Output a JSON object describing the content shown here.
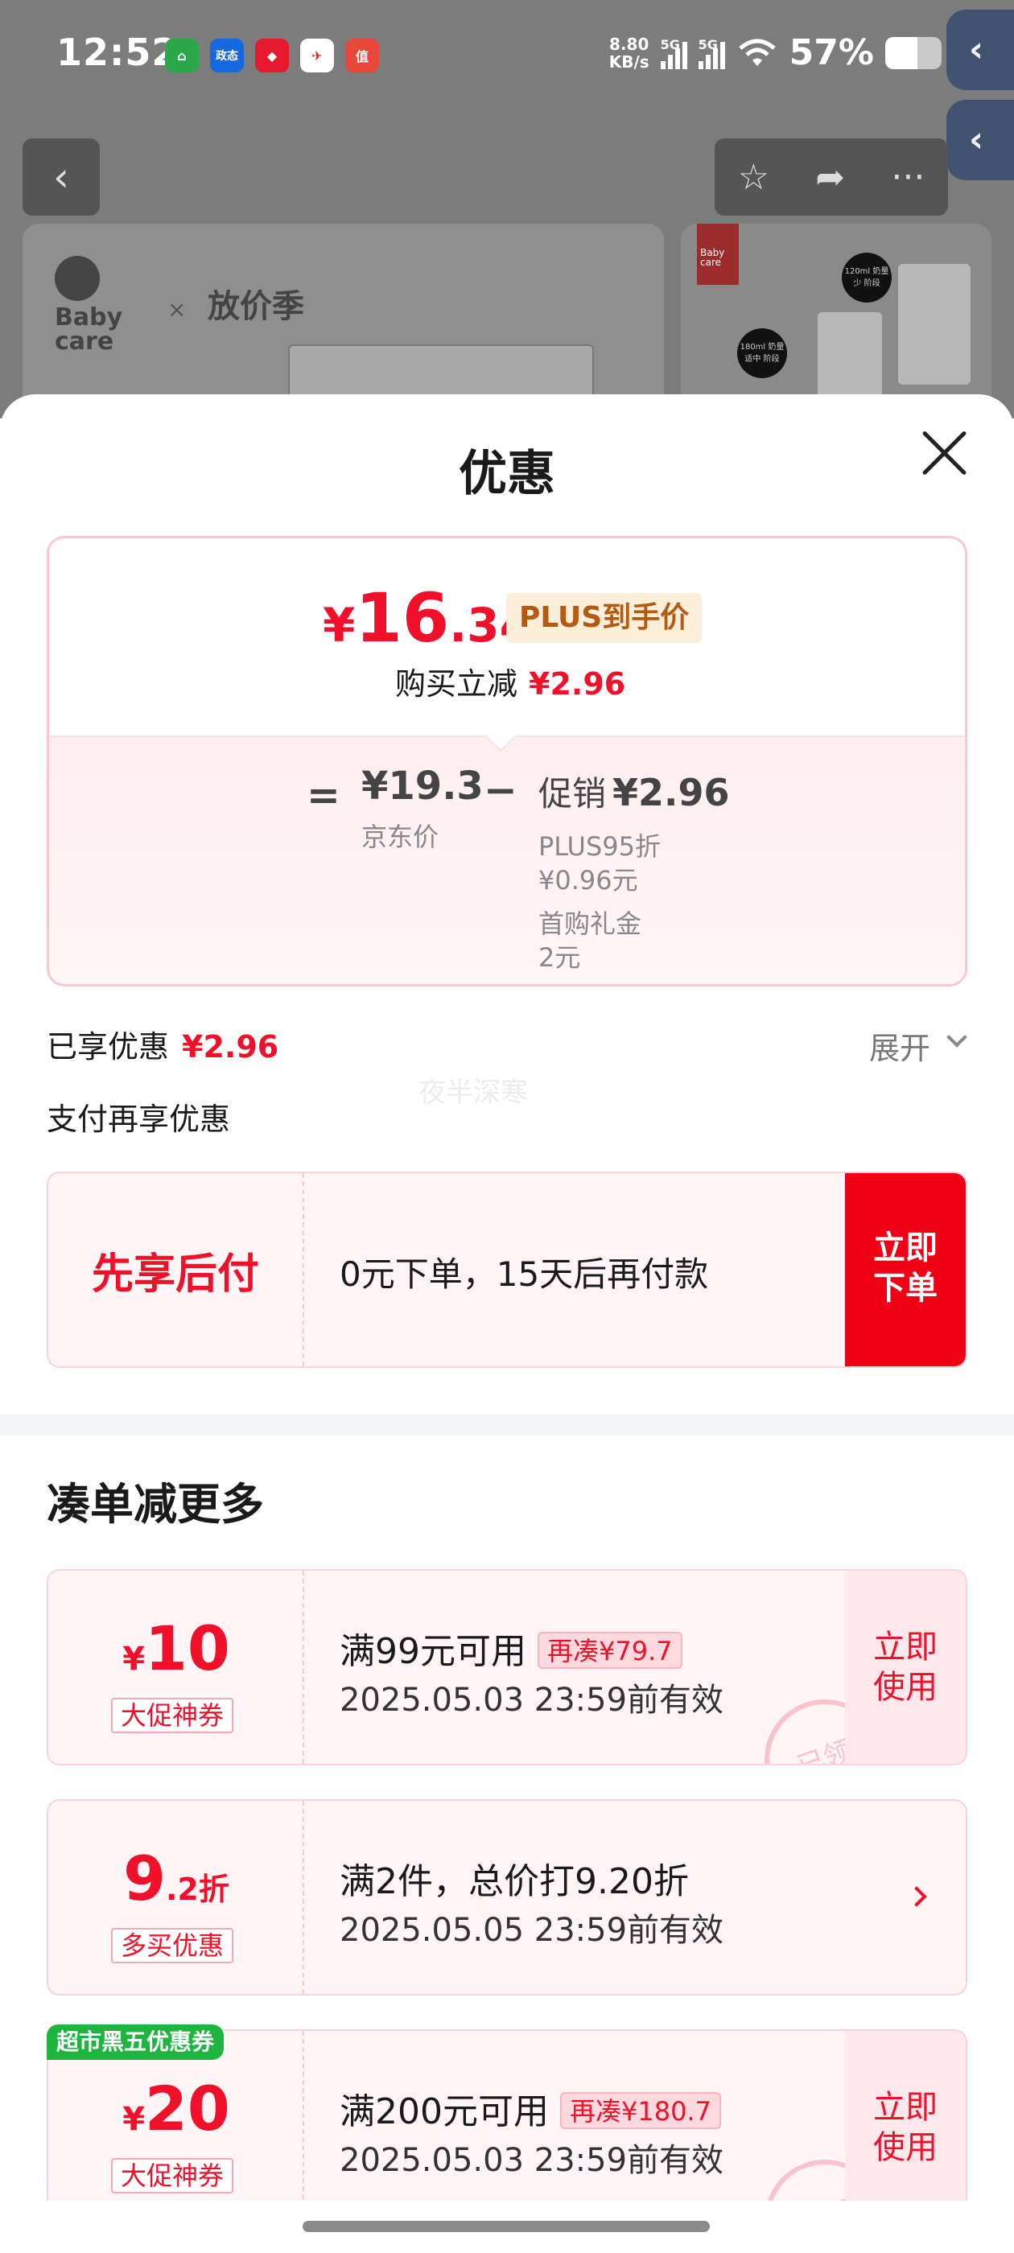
{
  "status_bar": {
    "time": "12:52",
    "apps": [
      {
        "icon": "home-app-icon",
        "label": "⌂",
        "bg": "#2aa84a"
      },
      {
        "icon": "stock-app-icon",
        "label": "政态",
        "bg": "#1668e0"
      },
      {
        "icon": "flag-app-icon",
        "label": "◆",
        "bg": "#e8192c"
      },
      {
        "icon": "bird-app-icon",
        "label": "✈",
        "bg": "#ffffff"
      },
      {
        "icon": "deal-app-icon",
        "label": "值",
        "bg": "#e8473a"
      }
    ],
    "net_speed": "8.80",
    "net_unit": "KB/s",
    "sig1": "5G",
    "sig2": "5G",
    "battery": "57%"
  },
  "background": {
    "brand1": "Baby\ncare",
    "brand_sep": "×",
    "brand2": "放价季",
    "product2_tag": "Baby care",
    "dot1": "120ml 奶量少 阶段",
    "dot2": "180ml 奶量适中 阶段"
  },
  "sheet": {
    "title": "优惠",
    "price": {
      "yen": "¥",
      "int": "16",
      "dec": ".34",
      "badge": "PLUS到手价",
      "discount_label": "购买立减",
      "discount_value": "¥2.96"
    },
    "breakdown": {
      "equals": "=",
      "jd_price": "¥19.3",
      "jd_label": "京东价",
      "minus": "−",
      "promo_label": "促销",
      "promo_value": "¥2.96",
      "line1": "PLUS95折",
      "line2": "¥0.96元",
      "line3": "首购礼金",
      "line4": "2元"
    },
    "enjoyed_label": "已享优惠",
    "enjoyed_value": "¥2.96",
    "expand_label": "展开",
    "watermark": "夜半深寒",
    "pay_more_label": "支付再享优惠",
    "bnpl": {
      "title": "先享后付",
      "desc": "0元下单，15天后再付款",
      "button": "立即\n下单"
    },
    "section_title": "凑单减更多",
    "coupons": [
      {
        "amount_prefix": "¥",
        "amount": "10",
        "amount_suffix": "",
        "tag": "大促神券",
        "condition": "满99元可用",
        "pill": "再凑¥79.7",
        "valid": "2025.05.03 23:59前有效",
        "action": "立即\n使用",
        "stamp": "已领"
      },
      {
        "amount_prefix": "",
        "amount": "9",
        "amount_suffix": ".2折",
        "tag": "多买优惠",
        "condition": "满2件，总价打9.20折",
        "pill": "",
        "valid": "2025.05.05 23:59前有效",
        "action": "",
        "stamp": ""
      },
      {
        "amount_prefix": "¥",
        "amount": "20",
        "amount_suffix": "",
        "tag": "大促神券",
        "condition": "满200元可用",
        "pill": "再凑¥180.7",
        "valid": "2025.05.03 23:59前有效",
        "action": "立即\n使用",
        "stamp": "已领"
      }
    ],
    "special_tag": "超市黑五优惠券"
  },
  "colors": {
    "accent_red": "#f0102a",
    "plus_bg": "#fcefd9",
    "special_green": "#1db53d"
  }
}
